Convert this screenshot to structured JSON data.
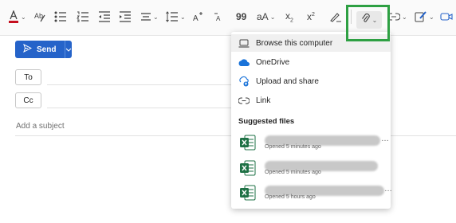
{
  "compose": {
    "send_label": "Send",
    "to_label": "To",
    "cc_label": "Cc",
    "subject_placeholder": "Add a subject"
  },
  "toolbar": {
    "font_size_label": "aA",
    "subscript_label": "x",
    "subscript_sub": "2",
    "superscript_label": "x",
    "superscript_sup": "2",
    "quote_label": "99",
    "icons": [
      "font-color",
      "format-painter",
      "bullets",
      "numbering",
      "decrease-indent",
      "increase-indent",
      "align",
      "line-spacing",
      "increase-font",
      "decrease-font",
      "quote",
      "font-case",
      "subscript",
      "superscript",
      "signature",
      "attach",
      "link",
      "editor",
      "meeting"
    ]
  },
  "attach_menu": {
    "items": [
      {
        "label": "Browse this computer",
        "icon": "laptop-icon"
      },
      {
        "label": "OneDrive",
        "icon": "onedrive-cloud-icon"
      },
      {
        "label": "Upload and share",
        "icon": "upload-share-icon"
      },
      {
        "label": "Link",
        "icon": "link-icon"
      }
    ],
    "suggested_title": "Suggested files",
    "files": [
      {
        "meta": "Opened 5 minutes ago"
      },
      {
        "meta": "Opened 5 minutes ago"
      },
      {
        "meta": "Opened 5 hours ago"
      }
    ]
  },
  "colors": {
    "accent": "#2563c9",
    "highlight_box": "#2ea043",
    "excel_green": "#1e7145",
    "font_color_bar": "#c50f1f"
  }
}
